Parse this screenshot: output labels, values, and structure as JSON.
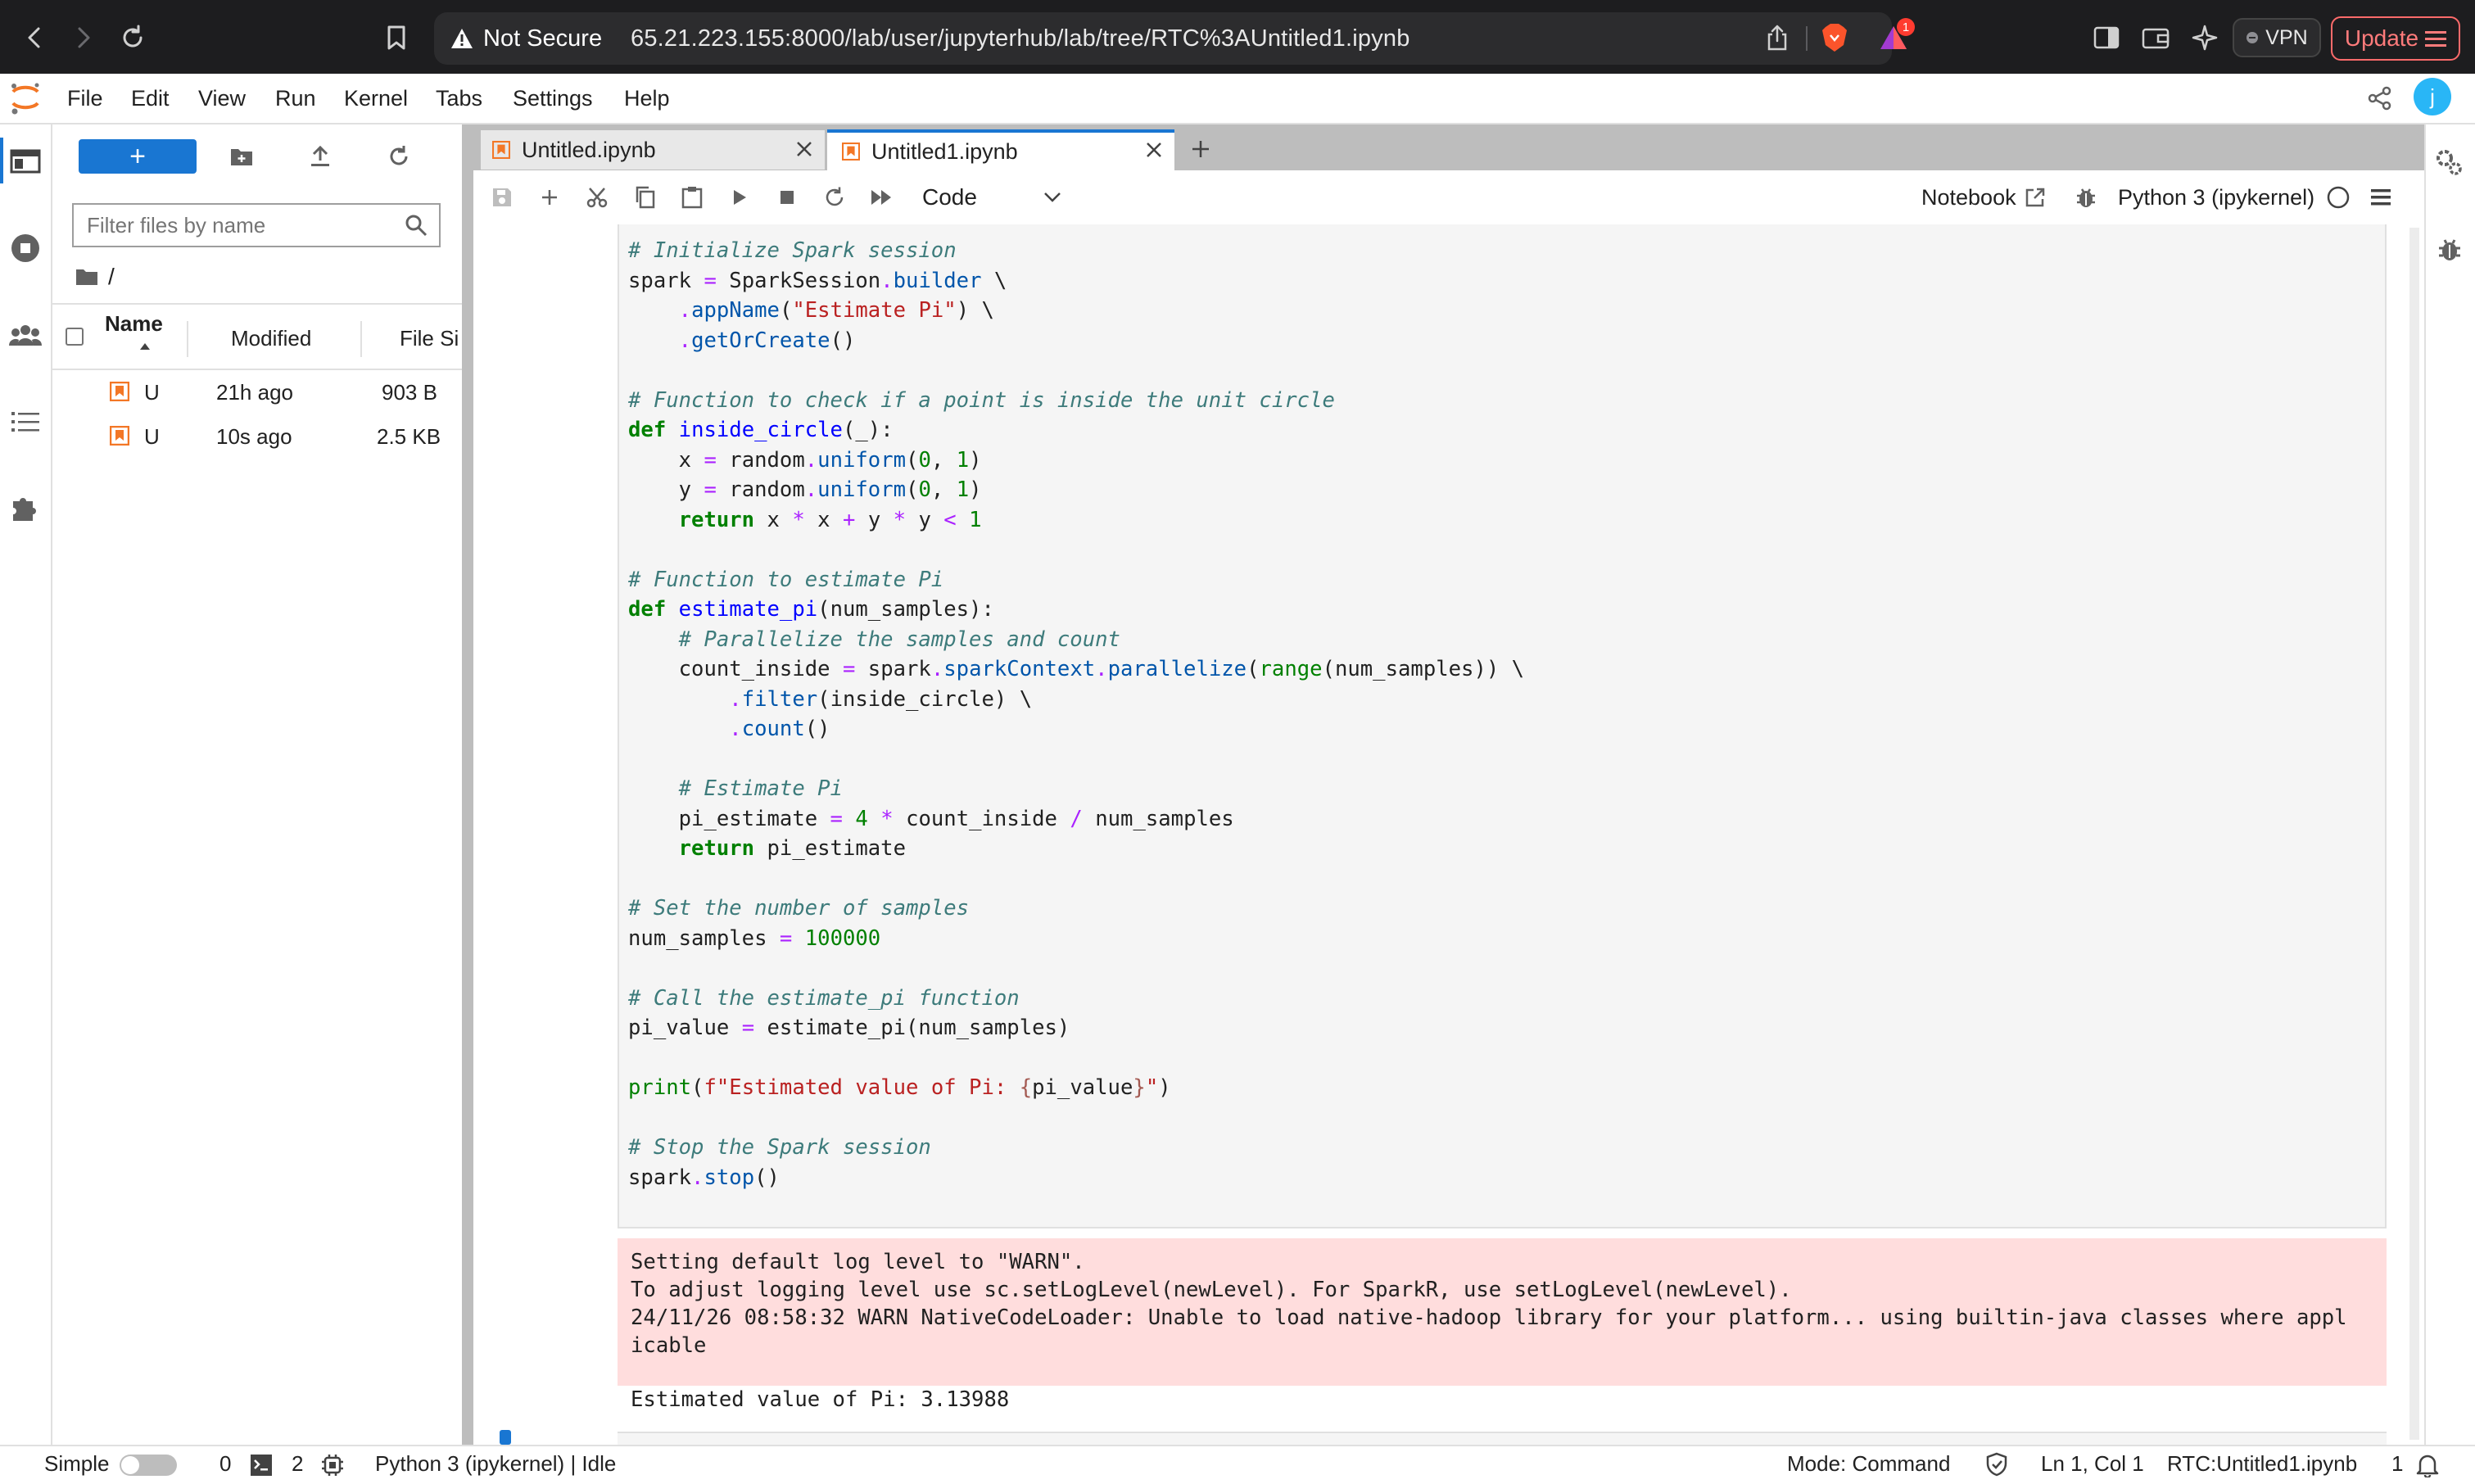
{
  "browser": {
    "security_label": "Not Secure",
    "url": "65.21.223.155:8000/lab/user/jupyterhub/lab/tree/RTC%3AUntitled1.ipynb",
    "notification_count": "1",
    "vpn_label": "VPN",
    "update_label": "Update"
  },
  "menu": {
    "items": [
      "File",
      "Edit",
      "View",
      "Run",
      "Kernel",
      "Tabs",
      "Settings",
      "Help"
    ],
    "user_initial": "j"
  },
  "file_browser": {
    "new_label": "+",
    "filter_placeholder": "Filter files by name",
    "breadcrumb": "/",
    "columns": [
      "Name",
      "Modified",
      "File Si"
    ],
    "files": [
      {
        "name": "U",
        "modified": "21h ago",
        "size": "903 B"
      },
      {
        "name": "U",
        "modified": "10s ago",
        "size": "2.5 KB"
      }
    ]
  },
  "tabs": [
    {
      "label": "Untitled.ipynb",
      "active": false
    },
    {
      "label": "Untitled1.ipynb",
      "active": true
    }
  ],
  "toolbar": {
    "cell_type": "Code",
    "notebook_label": "Notebook",
    "kernel_label": "Python 3 (ipykernel)"
  },
  "cell": {
    "stderr": [
      "Setting default log level to \"WARN\".",
      "To adjust logging level use sc.setLogLevel(newLevel). For SparkR, use setLogLevel(newLevel).",
      "24/11/26 08:58:32 WARN NativeCodeLoader: Unable to load native-hadoop library for your platform... using builtin-java classes where appl",
      "icable"
    ],
    "stdout": "Estimated value of Pi: 3.13988"
  },
  "status": {
    "mode_label": "Simple",
    "terminals_count": "0",
    "kernels_count": "2",
    "kernel_status": "Python 3 (ipykernel) | Idle",
    "command_mode": "Mode: Command",
    "cursor_pos": "Ln 1, Col 1",
    "doc_name": "RTC:Untitled1.ipynb",
    "notifications": "1"
  },
  "colors": {
    "accent": "#1976d2",
    "notebook_icon": "#f37726",
    "stderr_bg": "#ffdddd",
    "update_button": "#ff6b6b"
  },
  "icons": [
    "back-icon",
    "forward-icon",
    "reload-icon",
    "bookmark-icon",
    "warning-icon",
    "share-icon",
    "brave-lion-icon",
    "brave-rewards-icon",
    "sidebar-icon",
    "wallet-icon",
    "leo-ai-icon",
    "hamburger-icon",
    "jupyter-logo-icon",
    "folder-icon",
    "running-icon",
    "users-icon",
    "toc-icon",
    "extension-icon",
    "new-folder-icon",
    "upload-icon",
    "refresh-icon",
    "search-icon",
    "notebook-file-icon",
    "close-icon",
    "add-tab-icon",
    "save-icon",
    "add-cell-icon",
    "cut-icon",
    "copy-icon",
    "paste-icon",
    "run-icon",
    "stop-icon",
    "restart-icon",
    "run-all-icon",
    "chevron-down-icon",
    "external-link-icon",
    "bug-icon",
    "kernel-idle-icon",
    "menu-icon",
    "property-inspector-icon",
    "debugger-icon",
    "terminal-icon",
    "kernel-gear-icon",
    "shield-check-icon",
    "bell-icon"
  ]
}
